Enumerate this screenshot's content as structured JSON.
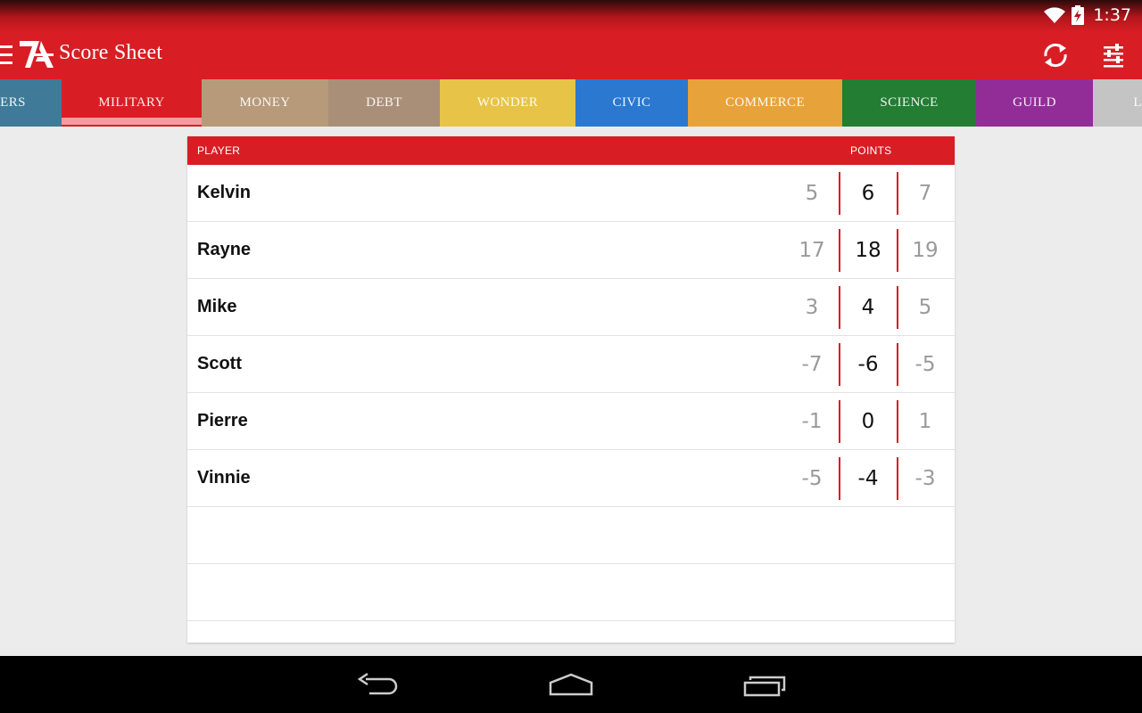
{
  "status_bar": {
    "time": "1:37"
  },
  "app_bar": {
    "title": "Score Sheet"
  },
  "tabs": [
    {
      "label": "ERS",
      "color": "#3f7b98",
      "selected": false
    },
    {
      "label": "MILITARY",
      "color": "#d81e24",
      "selected": true
    },
    {
      "label": "MONEY",
      "color": "#b79a7a",
      "selected": false
    },
    {
      "label": "DEBT",
      "color": "#a98f78",
      "selected": false
    },
    {
      "label": "WONDER",
      "color": "#e7c447",
      "selected": false
    },
    {
      "label": "CIVIC",
      "color": "#2a78d0",
      "selected": false
    },
    {
      "label": "COMMERCE",
      "color": "#e8a23a",
      "selected": false
    },
    {
      "label": "SCIENCE",
      "color": "#237d33",
      "selected": false
    },
    {
      "label": "GUILD",
      "color": "#922d98",
      "selected": false
    },
    {
      "label": "LE",
      "color": "#c4c4c4",
      "selected": false
    }
  ],
  "table": {
    "header_player": "PLAYER",
    "header_points": "POINTS",
    "rows": [
      {
        "name": "Kelvin",
        "prev": "5",
        "current": "6",
        "next": "7"
      },
      {
        "name": "Rayne",
        "prev": "17",
        "current": "18",
        "next": "19"
      },
      {
        "name": "Mike",
        "prev": "3",
        "current": "4",
        "next": "5"
      },
      {
        "name": "Scott",
        "prev": "-7",
        "current": "-6",
        "next": "-5"
      },
      {
        "name": "Pierre",
        "prev": "-1",
        "current": "0",
        "next": "1"
      },
      {
        "name": "Vinnie",
        "prev": "-5",
        "current": "-4",
        "next": "-3"
      }
    ]
  },
  "colors": {
    "accent": "#d81e24",
    "tab_indicator": "#f59aa1"
  }
}
